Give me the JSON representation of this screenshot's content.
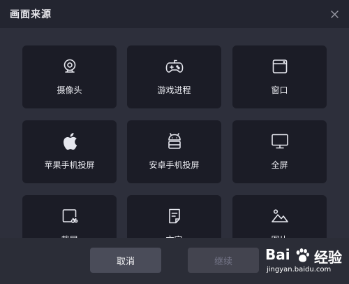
{
  "window": {
    "title": "画面来源",
    "close_icon": "close-icon"
  },
  "tiles": [
    {
      "label": "摄像头",
      "icon": "webcam-icon"
    },
    {
      "label": "游戏进程",
      "icon": "gamepad-icon"
    },
    {
      "label": "窗口",
      "icon": "window-icon"
    },
    {
      "label": "苹果手机投屏",
      "icon": "apple-icon"
    },
    {
      "label": "安卓手机投屏",
      "icon": "android-icon"
    },
    {
      "label": "全屏",
      "icon": "monitor-icon"
    },
    {
      "label": "截屏",
      "icon": "screenshot-icon"
    },
    {
      "label": "文字",
      "icon": "text-document-icon"
    },
    {
      "label": "图片",
      "icon": "image-icon"
    }
  ],
  "footer": {
    "cancel_label": "取消",
    "continue_label": "继续"
  },
  "watermark": {
    "brand": "Bai",
    "brand2": "经验",
    "url": "jingyan.baidu.com"
  },
  "colors": {
    "background": "#2b2d37",
    "tile": "#1b1c26",
    "cancel_button": "#4a4c59",
    "continue_button_disabled": "#43444f"
  }
}
